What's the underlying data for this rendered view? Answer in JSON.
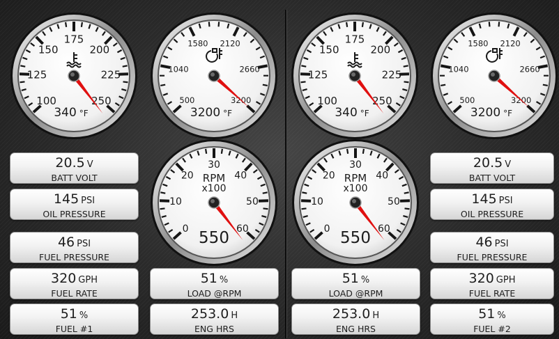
{
  "dashboard": {
    "left": {
      "temp_gauge": {
        "ticks": [
          "100",
          "125",
          "150",
          "175",
          "200",
          "225",
          "250"
        ],
        "readout": "340",
        "unit": "°F",
        "icon": "coolant-temp-icon"
      },
      "temp2_gauge": {
        "ticks": [
          "500",
          "1040",
          "1580",
          "2120",
          "2660",
          "3200"
        ],
        "readout": "3200",
        "unit": "°F",
        "icon": "exhaust-temp-icon"
      },
      "rpm_gauge": {
        "ticks": [
          "0",
          "10",
          "20",
          "30",
          "40",
          "50",
          "60"
        ],
        "title": "RPM",
        "subtitle": "x100",
        "readout": "550"
      },
      "panels": [
        {
          "value": "20.5",
          "unit": "V",
          "label": "BATT VOLT"
        },
        {
          "value": "145",
          "unit": "PSI",
          "label": "OIL PRESSURE"
        },
        {
          "value": "46",
          "unit": "PSI",
          "label": "FUEL PRESSURE"
        },
        {
          "value": "320",
          "unit": "GPH",
          "label": "FUEL RATE"
        },
        {
          "value": "51",
          "unit": "%",
          "label": "FUEL #1"
        },
        {
          "value": "51",
          "unit": "%",
          "label": "LOAD @RPM"
        },
        {
          "value": "253.0",
          "unit": "H",
          "label": "ENG HRS"
        }
      ]
    },
    "right": {
      "temp_gauge": {
        "ticks": [
          "100",
          "125",
          "150",
          "175",
          "200",
          "225",
          "250"
        ],
        "readout": "340",
        "unit": "°F",
        "icon": "coolant-temp-icon"
      },
      "temp2_gauge": {
        "ticks": [
          "500",
          "1040",
          "1580",
          "2120",
          "2660",
          "3200"
        ],
        "readout": "3200",
        "unit": "°F",
        "icon": "exhaust-temp-icon"
      },
      "rpm_gauge": {
        "ticks": [
          "0",
          "10",
          "20",
          "30",
          "40",
          "50",
          "60"
        ],
        "title": "RPM",
        "subtitle": "x100",
        "readout": "550"
      },
      "panels": [
        {
          "value": "51",
          "unit": "%",
          "label": "LOAD @RPM"
        },
        {
          "value": "253.0",
          "unit": "H",
          "label": "ENG HRS"
        },
        {
          "value": "20.5",
          "unit": "V",
          "label": "BATT VOLT"
        },
        {
          "value": "145",
          "unit": "PSI",
          "label": "OIL PRESSURE"
        },
        {
          "value": "46",
          "unit": "PSI",
          "label": "FUEL PRESSURE"
        },
        {
          "value": "320",
          "unit": "GPH",
          "label": "FUEL RATE"
        },
        {
          "value": "51",
          "unit": "%",
          "label": "FUEL #2"
        }
      ]
    },
    "needle_color": "#e01010"
  }
}
